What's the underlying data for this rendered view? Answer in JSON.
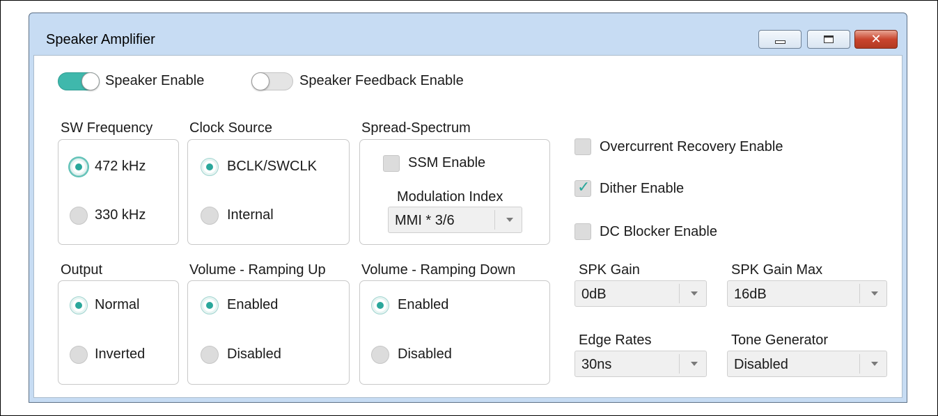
{
  "window": {
    "title": "Speaker Amplifier",
    "controls": [
      "minimize-icon",
      "maximize-icon",
      "close-icon"
    ]
  },
  "toggles": {
    "speaker_enable": {
      "label": "Speaker Enable",
      "on": true
    },
    "speaker_feedback_enable": {
      "label": "Speaker Feedback Enable",
      "on": false
    }
  },
  "sw_frequency": {
    "title": "SW Frequency",
    "options": [
      "472 kHz",
      "330 kHz"
    ],
    "selected": "472 kHz"
  },
  "clock_source": {
    "title": "Clock Source",
    "options": [
      "BCLK/SWCLK",
      "Internal"
    ],
    "selected": "BCLK/SWCLK"
  },
  "spread_spectrum": {
    "title": "Spread-Spectrum",
    "ssm_enable_label": "SSM Enable",
    "ssm_enable_checked": false,
    "modulation_index_label": "Modulation Index",
    "modulation_index_value": "MMI * 3/6"
  },
  "output": {
    "title": "Output",
    "options": [
      "Normal",
      "Inverted"
    ],
    "selected": "Normal"
  },
  "volume_ramping_up": {
    "title": "Volume - Ramping Up",
    "options": [
      "Enabled",
      "Disabled"
    ],
    "selected": "Enabled"
  },
  "volume_ramping_down": {
    "title": "Volume - Ramping Down",
    "options": [
      "Enabled",
      "Disabled"
    ],
    "selected": "Enabled"
  },
  "checkboxes": {
    "overcurrent_recovery": {
      "label": "Overcurrent Recovery Enable",
      "checked": false
    },
    "dither": {
      "label": "Dither Enable",
      "checked": true
    },
    "dc_blocker": {
      "label": "DC Blocker Enable",
      "checked": false
    }
  },
  "dropdowns": {
    "spk_gain": {
      "label": "SPK Gain",
      "value": "0dB"
    },
    "spk_gain_max": {
      "label": "SPK Gain Max",
      "value": "16dB"
    },
    "edge_rates": {
      "label": "Edge Rates",
      "value": "30ns"
    },
    "tone_generator": {
      "label": "Tone Generator",
      "value": "Disabled"
    }
  },
  "colors": {
    "accent": "#2aa79b",
    "toggle_on": "#3fb8ac",
    "frame": "#c7dcf3",
    "close": "#c9452e"
  }
}
